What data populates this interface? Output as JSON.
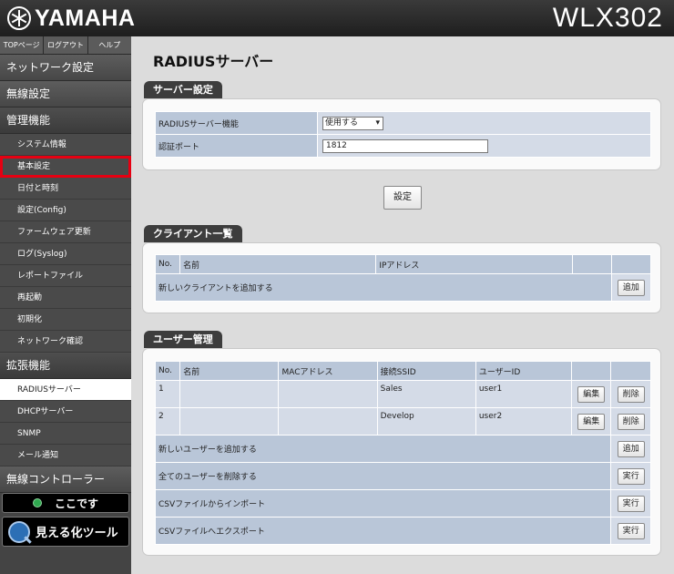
{
  "header": {
    "brand": "YAMAHA",
    "model": "WLX302"
  },
  "topnav": [
    "TOPページ",
    "ログアウト",
    "ヘルプ"
  ],
  "nav": {
    "network": "ネットワーク設定",
    "wireless": "無線設定",
    "admin": "管理機能",
    "admin_items": [
      "システム情報",
      "基本設定",
      "日付と時刻",
      "設定(Config)",
      "ファームウェア更新",
      "ログ(Syslog)",
      "レポートファイル",
      "再起動",
      "初期化",
      "ネットワーク確認"
    ],
    "ext": "拡張機能",
    "ext_items": [
      "RADIUSサーバー",
      "DHCPサーバー",
      "SNMP",
      "メール通知"
    ],
    "controller": "無線コントローラー",
    "here_btn": "ここです",
    "tool_btn": "見える化ツール"
  },
  "page": {
    "title": "RADIUSサーバー",
    "server": {
      "label": "サーバー設定",
      "func_label": "RADIUSサーバー機能",
      "func_value": "使用する",
      "port_label": "認証ポート",
      "port_value": "1812"
    },
    "set_button": "設定",
    "clients": {
      "label": "クライアント一覧",
      "headers": [
        "No.",
        "名前",
        "IPアドレス"
      ],
      "add_text": "新しいクライアントを追加する",
      "add_button": "追加"
    },
    "users": {
      "label": "ユーザー管理",
      "headers": [
        "No.",
        "名前",
        "MACアドレス",
        "接続SSID",
        "ユーザーID"
      ],
      "rows": [
        {
          "no": "1",
          "name": "",
          "mac": "",
          "ssid": "Sales",
          "uid": "user1"
        },
        {
          "no": "2",
          "name": "",
          "mac": "",
          "ssid": "Develop",
          "uid": "user2"
        }
      ],
      "edit_button": "編集",
      "delete_button": "削除",
      "actions": [
        {
          "text": "新しいユーザーを追加する",
          "button": "追加"
        },
        {
          "text": "全てのユーザーを削除する",
          "button": "実行"
        },
        {
          "text": "CSVファイルからインポート",
          "button": "実行"
        },
        {
          "text": "CSVファイルへエクスポート",
          "button": "実行"
        }
      ]
    }
  },
  "colors": {
    "highlight": "#e60012",
    "table_header": "#b9c6d8",
    "panel_label_bg": "#3d3d3d"
  }
}
